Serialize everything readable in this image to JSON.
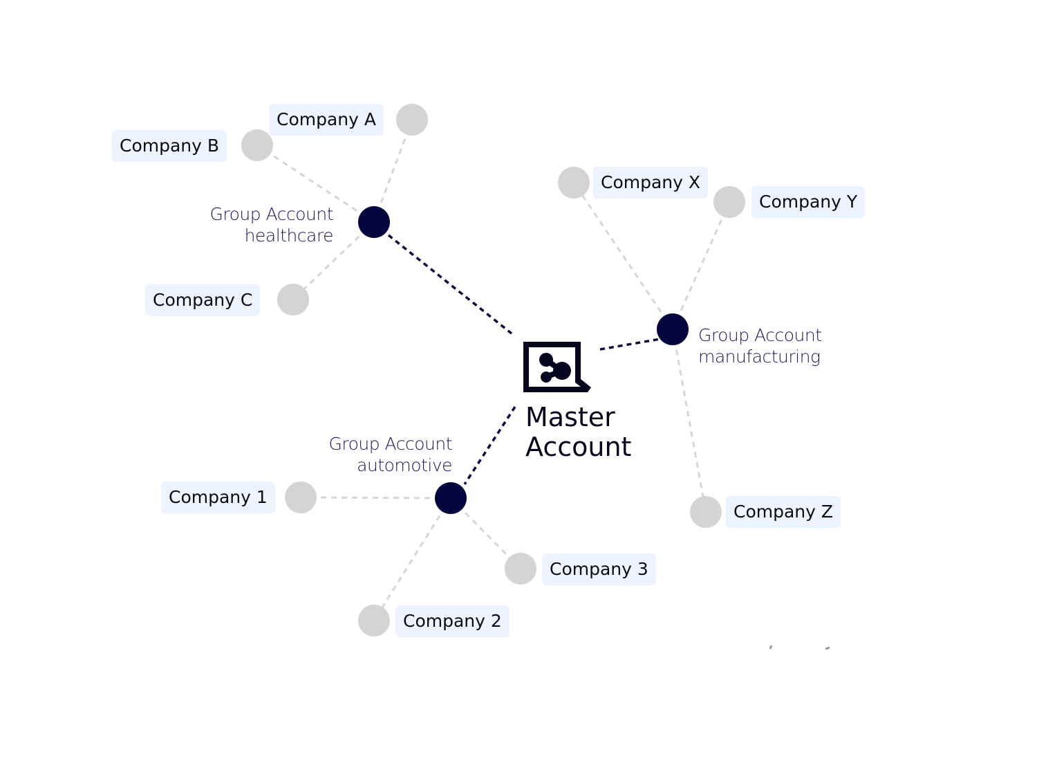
{
  "master": {
    "label_line1": "Master",
    "label_line2": "Account",
    "icon": "network-share-icon"
  },
  "groups": [
    {
      "id": "healthcare",
      "line1": "Group Account",
      "line2": "healthcare",
      "companies": [
        "Company A",
        "Company B",
        "Company C"
      ]
    },
    {
      "id": "manufacturing",
      "line1": "Group Account",
      "line2": "manufacturing",
      "companies": [
        "Company X",
        "Company Y",
        "Company Z"
      ]
    },
    {
      "id": "automotive",
      "line1": "Group Account",
      "line2": "automotive",
      "companies": [
        "Company 1",
        "Company 3",
        "Company 2"
      ]
    }
  ],
  "colors": {
    "group_node": "#03053f",
    "company_node": "#d4d4d4",
    "label_bg": "#eef4ff",
    "master_link": "#0a0a40",
    "company_link": "#d6d6d6"
  }
}
